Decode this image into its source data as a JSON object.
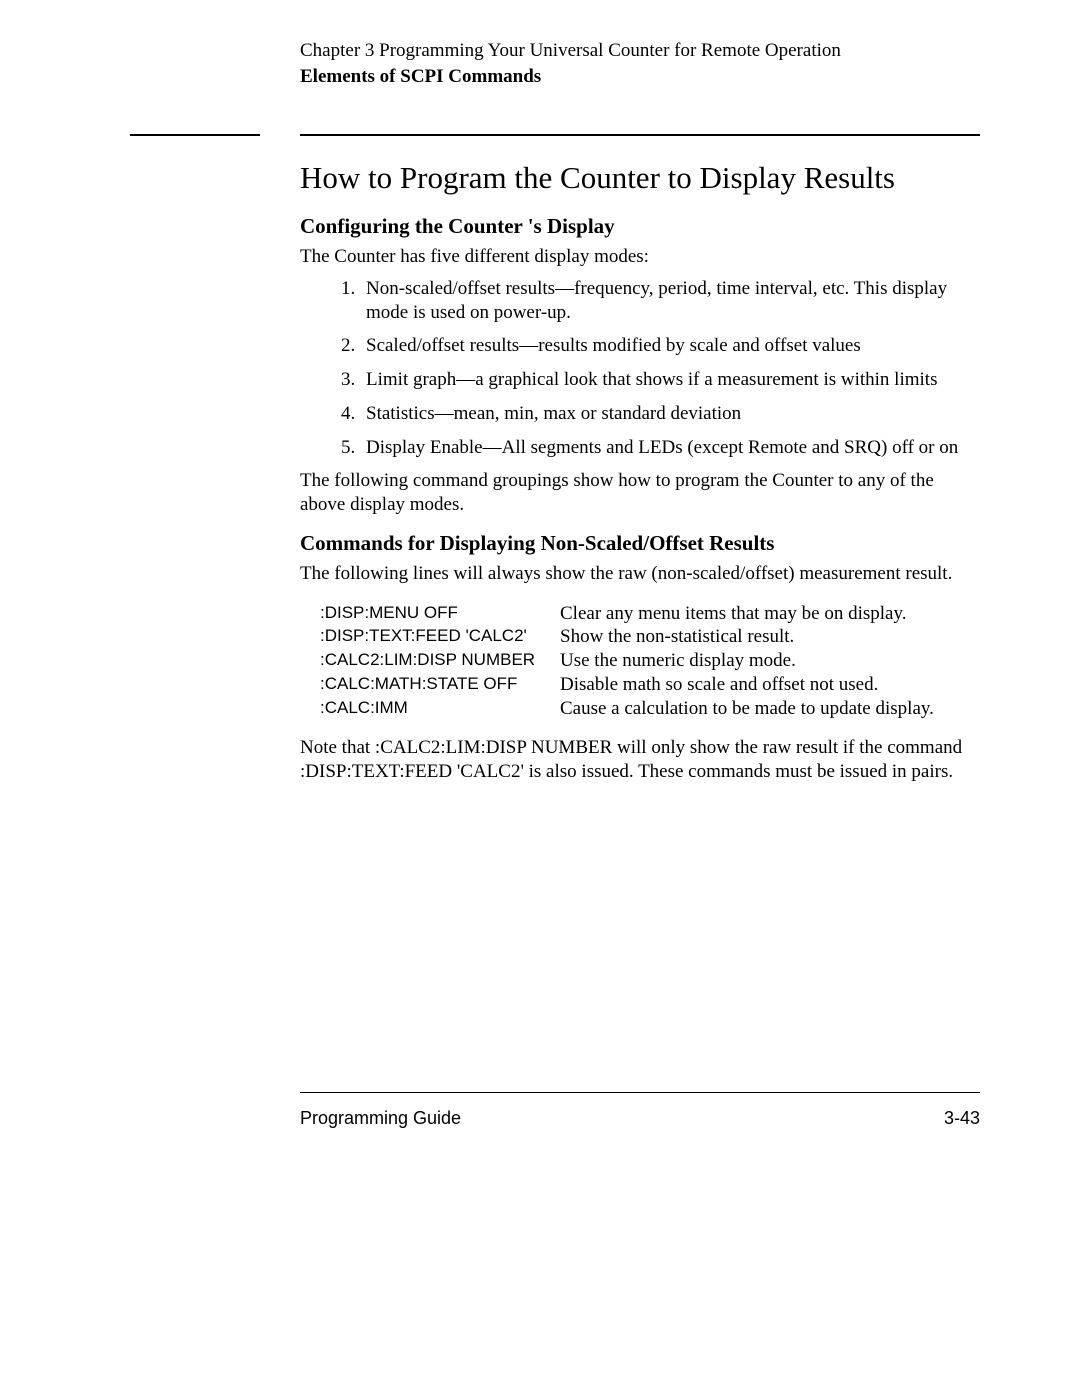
{
  "header": {
    "chapter": "Chapter 3  Programming Your Universal Counter for Remote Operation",
    "section": "Elements of SCPI Commands"
  },
  "title": "How to Program the Counter to Display Results",
  "subhead1": "Configuring the Counter 's Display",
  "intro1": "The Counter has five different display modes:",
  "modes": [
    "Non-scaled/offset results—frequency, period, time interval, etc. This display mode is used on power-up.",
    "Scaled/offset results—results modified by scale and offset values",
    "Limit graph—a graphical look that shows if a measurement is within limits",
    "Statistics—mean, min, max or standard deviation",
    "Display Enable—All segments and LEDs (except Remote and SRQ) off or on"
  ],
  "para_after_list": "The following command groupings show how to program the Counter to any of the above display modes.",
  "subhead2": "Commands for Displaying Non-Scaled/Offset Results",
  "intro2": "The following lines will always show the raw (non-scaled/offset) measurement result.",
  "commands": [
    {
      "cmd": ":DISP:MENU OFF",
      "desc": "Clear any menu items that may be on display."
    },
    {
      "cmd": ":DISP:TEXT:FEED 'CALC2'",
      "desc": "Show the non-statistical result."
    },
    {
      "cmd": ":CALC2:LIM:DISP NUMBER",
      "desc": "Use the numeric display mode."
    },
    {
      "cmd": ":CALC:MATH:STATE OFF",
      "desc": "Disable math so scale and offset not used."
    },
    {
      "cmd": ":CALC:IMM",
      "desc": "Cause a calculation to be made to update display."
    }
  ],
  "note": "Note that :CALC2:LIM:DISP NUMBER will only show the raw result if the command :DISP:TEXT:FEED  'CALC2' is also issued. These commands must be issued in pairs.",
  "footer": {
    "left": "Programming Guide",
    "right": "3-43"
  }
}
